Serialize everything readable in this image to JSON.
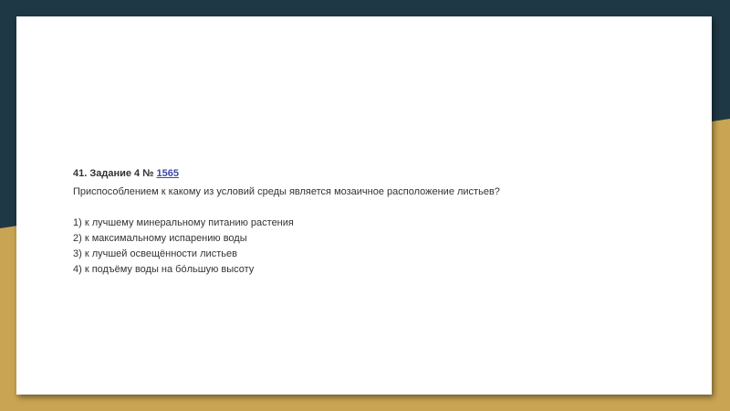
{
  "colors": {
    "background_dark": "#1f3845",
    "background_gold": "#c9a553",
    "slide": "#ffffff",
    "text": "#333333",
    "link": "#3a49a8"
  },
  "task": {
    "number": "41.",
    "label": "Задание 4 №",
    "id_link": "1565",
    "question": "Приспособлением к какому из условий среды является мозаичное расположение листьев?",
    "options": [
      "1) к лучшему минеральному питанию растения",
      "2) к максимальному испарению воды",
      "3) к лучшей освещённости листьев",
      "4) к подъёму воды на бóльшую высоту"
    ]
  }
}
